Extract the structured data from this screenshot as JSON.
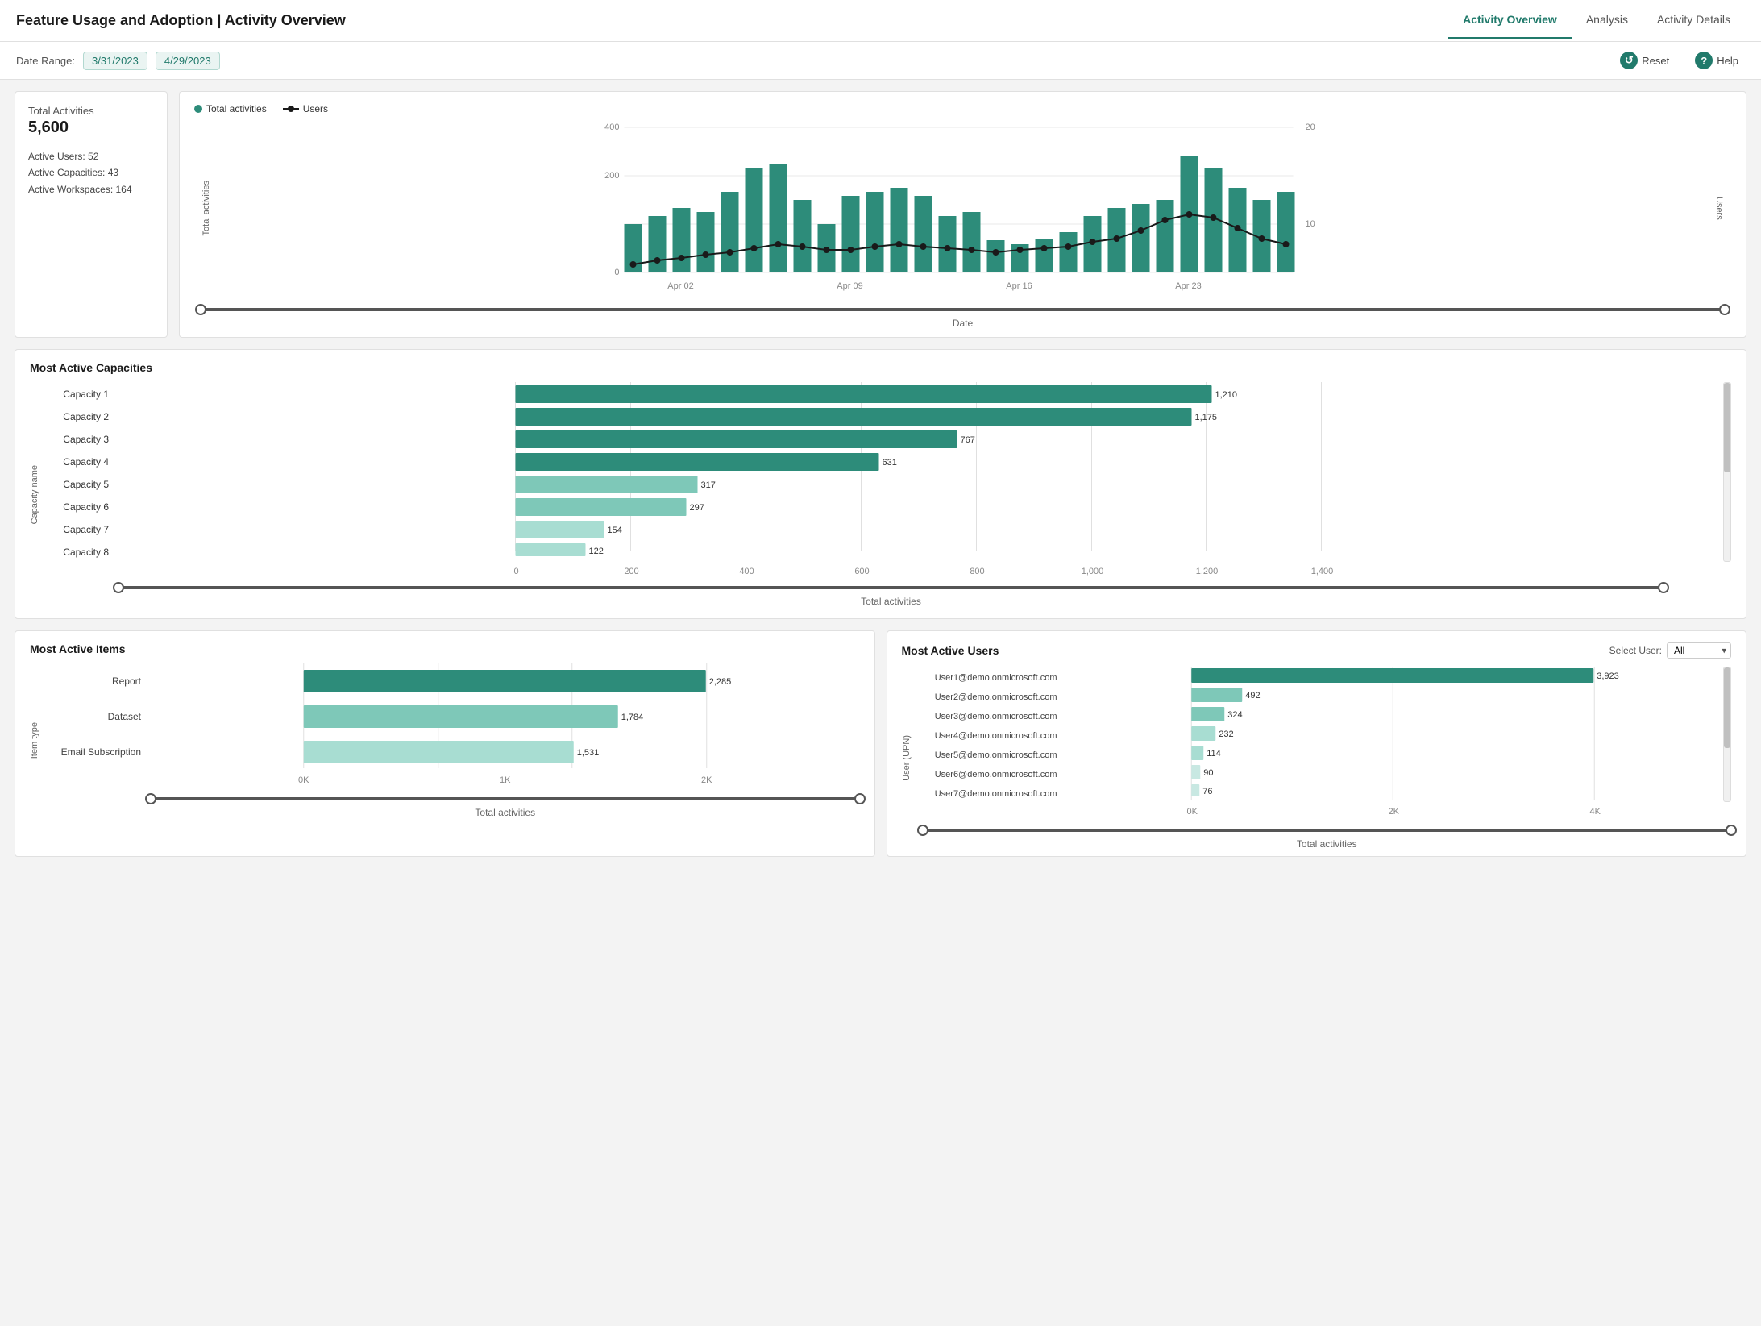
{
  "app": {
    "title": "Feature Usage and Adoption | Activity Overview"
  },
  "nav": {
    "tabs": [
      {
        "id": "activity-overview",
        "label": "Activity Overview",
        "active": true
      },
      {
        "id": "analysis",
        "label": "Analysis",
        "active": false
      },
      {
        "id": "activity-details",
        "label": "Activity Details",
        "active": false
      }
    ]
  },
  "toolbar": {
    "date_label": "Date Range:",
    "date_start": "3/31/2023",
    "date_end": "4/29/2023",
    "reset_label": "Reset",
    "help_label": "Help"
  },
  "summary": {
    "total_activities_label": "Total Activities",
    "total_activities_value": "5,600",
    "active_users_label": "Active Users:",
    "active_users_value": "52",
    "active_capacities_label": "Active Capacities:",
    "active_capacities_value": "43",
    "active_workspaces_label": "Active Workspaces:",
    "active_workspaces_value": "164"
  },
  "activity_chart": {
    "legend_total": "Total activities",
    "legend_users": "Users",
    "y_axis_label": "Total activities",
    "y_axis_right_label": "Users",
    "x_axis_label": "Date",
    "x_ticks": [
      "Apr 02",
      "Apr 09",
      "Apr 16",
      "Apr 23"
    ],
    "y_ticks": [
      "0",
      "200",
      "400"
    ],
    "y_right_ticks": [
      "10",
      "20"
    ],
    "slider_label": "Date"
  },
  "capacity_chart": {
    "title": "Most Active Capacities",
    "y_axis_label": "Capacity name",
    "x_axis_label": "Total activities",
    "x_ticks": [
      "0",
      "200",
      "400",
      "600",
      "800",
      "1,000",
      "1,200",
      "1,400"
    ],
    "slider_label": "Total activities",
    "max_value": 1400,
    "bars": [
      {
        "label": "Capacity 1",
        "value": 1210,
        "color": "#2d8c7a"
      },
      {
        "label": "Capacity 2",
        "value": 1175,
        "color": "#2d8c7a"
      },
      {
        "label": "Capacity 3",
        "value": 767,
        "color": "#2d8c7a"
      },
      {
        "label": "Capacity 4",
        "value": 631,
        "color": "#2d8c7a"
      },
      {
        "label": "Capacity 5",
        "value": 317,
        "color": "#7ec8b8"
      },
      {
        "label": "Capacity 6",
        "value": 297,
        "color": "#7ec8b8"
      },
      {
        "label": "Capacity 7",
        "value": 154,
        "color": "#a8ddd2"
      },
      {
        "label": "Capacity 8",
        "value": 122,
        "color": "#a8ddd2"
      }
    ]
  },
  "items_chart": {
    "title": "Most Active Items",
    "y_axis_label": "Item type",
    "x_axis_label": "Total activities",
    "x_ticks": [
      "0K",
      "1K",
      "2K"
    ],
    "slider_label": "Total activities",
    "max_value": 2285,
    "bars": [
      {
        "label": "Report",
        "value": 2285,
        "color": "#2d8c7a"
      },
      {
        "label": "Dataset",
        "value": 1784,
        "color": "#7ec8b8"
      },
      {
        "label": "Email Subscription",
        "value": 1531,
        "color": "#a8ddd2"
      }
    ]
  },
  "users_chart": {
    "title": "Most Active Users",
    "select_label": "Select User:",
    "select_value": "All",
    "select_options": [
      "All"
    ],
    "y_axis_label": "User (UPN)",
    "x_axis_label": "Total activities",
    "x_ticks": [
      "0K",
      "2K",
      "4K"
    ],
    "slider_label": "Total activities",
    "max_value": 3923,
    "bars": [
      {
        "label": "User1@demo.onmicrosoft.com",
        "value": 3923,
        "color": "#2d8c7a"
      },
      {
        "label": "User2@demo.onmicrosoft.com",
        "value": 492,
        "color": "#7ec8b8"
      },
      {
        "label": "User3@demo.onmicrosoft.com",
        "value": 324,
        "color": "#7ec8b8"
      },
      {
        "label": "User4@demo.onmicrosoft.com",
        "value": 232,
        "color": "#a8ddd2"
      },
      {
        "label": "User5@demo.onmicrosoft.com",
        "value": 114,
        "color": "#a8ddd2"
      },
      {
        "label": "User6@demo.onmicrosoft.com",
        "value": 90,
        "color": "#c8e8e2"
      },
      {
        "label": "User7@demo.onmicrosoft.com",
        "value": 76,
        "color": "#c8e8e2"
      }
    ]
  },
  "colors": {
    "accent": "#217a6b",
    "bar_dark": "#2d8c7a",
    "bar_mid": "#7ec8b8",
    "bar_light": "#a8ddd2",
    "bar_lighter": "#c8e8e2"
  }
}
